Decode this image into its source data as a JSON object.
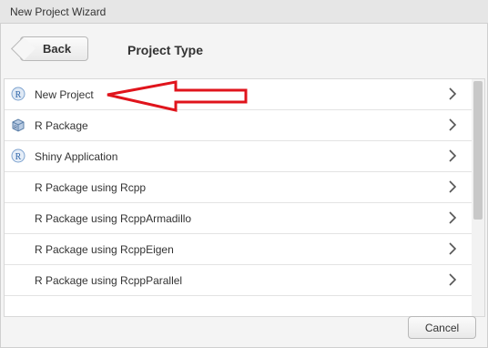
{
  "window": {
    "title": "New Project Wizard"
  },
  "header": {
    "back_label": "Back",
    "title": "Project Type"
  },
  "project_types": [
    {
      "label": "New Project",
      "icon": "r-project-icon"
    },
    {
      "label": "R Package",
      "icon": "r-package-icon"
    },
    {
      "label": "Shiny Application",
      "icon": "shiny-app-icon"
    },
    {
      "label": "R Package using Rcpp",
      "icon": ""
    },
    {
      "label": "R Package using RcppArmadillo",
      "icon": ""
    },
    {
      "label": "R Package using RcppEigen",
      "icon": ""
    },
    {
      "label": "R Package using RcppParallel",
      "icon": ""
    }
  ],
  "footer": {
    "cancel_label": "Cancel"
  },
  "colors": {
    "annotation_arrow": "#e0141c",
    "r_icon": "#5b8fc7"
  }
}
